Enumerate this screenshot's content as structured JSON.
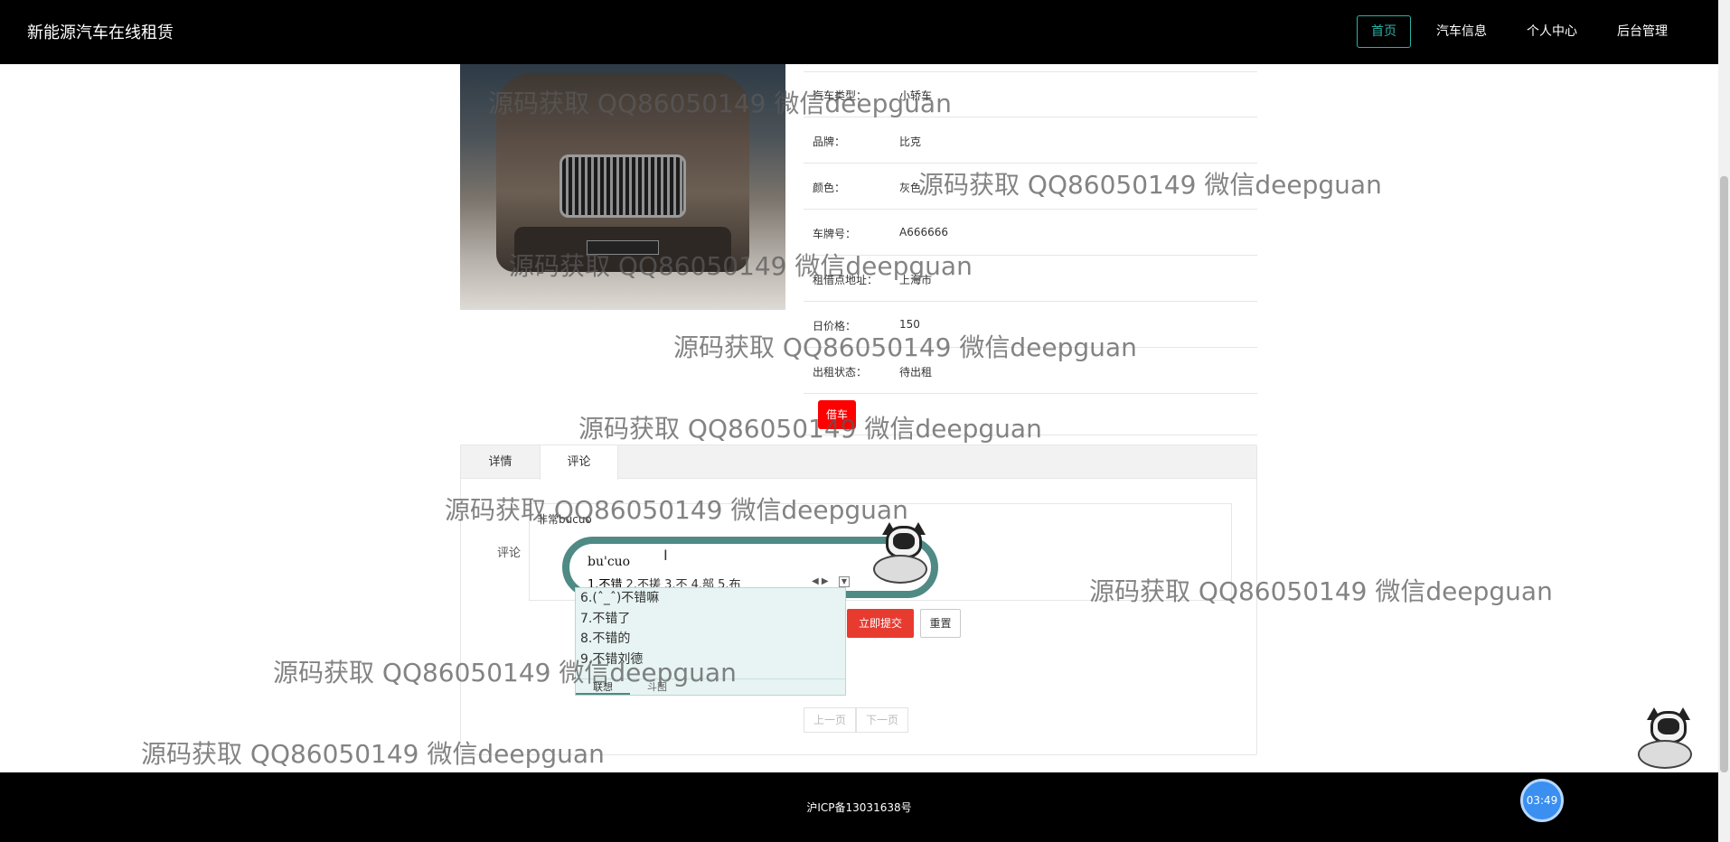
{
  "brand": "新能源汽车在线租赁",
  "nav": [
    {
      "label": "首页",
      "active": true
    },
    {
      "label": "汽车信息",
      "active": false
    },
    {
      "label": "个人中心",
      "active": false
    },
    {
      "label": "后台管理",
      "active": false
    }
  ],
  "car": {
    "rows": [
      {
        "key": "汽车类型：",
        "value": "小轿车"
      },
      {
        "key": "品牌：",
        "value": "比克"
      },
      {
        "key": "颜色：",
        "value": "灰色"
      },
      {
        "key": "车牌号：",
        "value": "A666666"
      },
      {
        "key": "租借点地址：",
        "value": "上海市"
      },
      {
        "key": "日价格：",
        "value": "150"
      },
      {
        "key": "出租状态：",
        "value": "待出租"
      }
    ],
    "borrow_label": "借车"
  },
  "tabs": [
    {
      "label": "详情",
      "active": false
    },
    {
      "label": "评论",
      "active": true
    }
  ],
  "comment": {
    "label": "评论",
    "value": "非常bucuo",
    "submit_label": "立即提交",
    "reset_label": "重置"
  },
  "pager": {
    "prev": "上一页",
    "next": "下一页"
  },
  "ime": {
    "pinyin": "bu'cuo",
    "candidates_line": "2.不搓  3.不  4.部  5.布",
    "first_candidate": "1.不错",
    "list": [
      "6.(ˆ_ˆ)不错嘛",
      "7.不错了",
      "8.不错的",
      "9.不错刘德"
    ],
    "tabs": [
      "联想",
      "斗图"
    ]
  },
  "footer": {
    "icp": "沪ICP备13031638号"
  },
  "clock": "03:49",
  "watermark": "源码获取 QQ86050149 微信deepguan"
}
